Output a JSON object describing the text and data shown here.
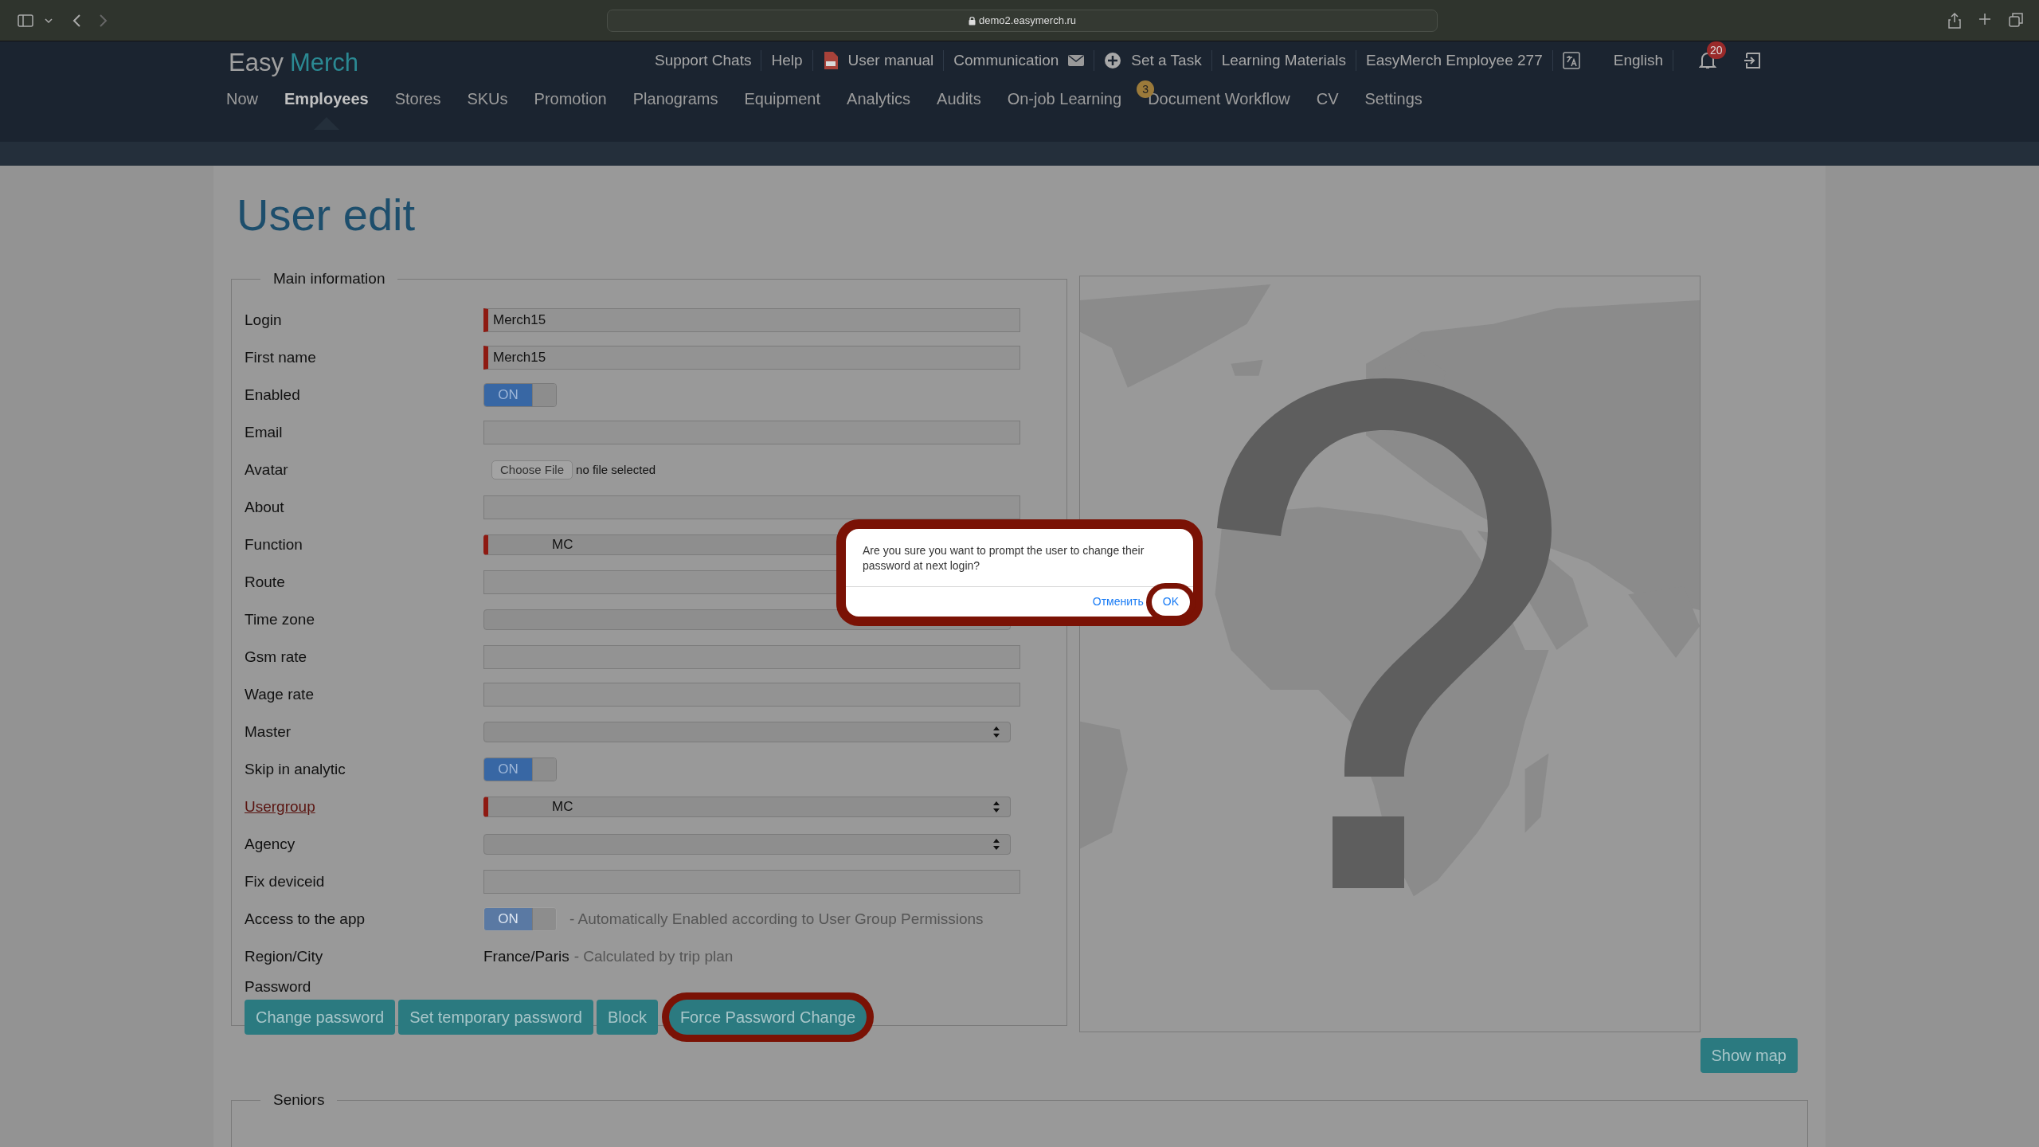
{
  "browser": {
    "url": "demo2.easymerch.ru"
  },
  "header": {
    "logo": {
      "first": "Easy",
      "second": "Merch"
    },
    "support_chats": "Support Chats",
    "help": "Help",
    "user_manual": "User manual",
    "communication": "Communication",
    "set_a_task": "Set a Task",
    "learning_materials": "Learning Materials",
    "user_name": "EasyMerch Employee 277",
    "language": "English",
    "notifications": "20",
    "nav": [
      {
        "label": "Now",
        "selected": false
      },
      {
        "label": "Employees",
        "selected": true
      },
      {
        "label": "Stores",
        "selected": false
      },
      {
        "label": "SKUs",
        "selected": false
      },
      {
        "label": "Promotion",
        "selected": false
      },
      {
        "label": "Planograms",
        "selected": false
      },
      {
        "label": "Equipment",
        "selected": false
      },
      {
        "label": "Analytics",
        "selected": false
      },
      {
        "label": "Audits",
        "selected": false
      },
      {
        "label": "On-job Learning",
        "selected": false
      },
      {
        "label": "Document Workflow",
        "selected": false,
        "badge": "3"
      },
      {
        "label": "CV",
        "selected": false
      },
      {
        "label": "Settings",
        "selected": false
      }
    ]
  },
  "title": "User edit",
  "main_information": {
    "legend": "Main information",
    "rows": [
      {
        "kind": "text",
        "label": "Login",
        "value": "Merch15",
        "required": true
      },
      {
        "kind": "text",
        "label": "First name",
        "value": "Merch15",
        "required": true
      },
      {
        "kind": "toggle",
        "label": "Enabled",
        "toggle": "ON",
        "on": true,
        "disabled": false
      },
      {
        "kind": "text",
        "label": "Email",
        "required": false
      },
      {
        "kind": "file",
        "label": "Avatar",
        "button": "Choose File",
        "status": "no file selected"
      },
      {
        "kind": "text",
        "label": "About",
        "required": false
      },
      {
        "kind": "select",
        "label": "Function",
        "value": "MC",
        "required": true
      },
      {
        "kind": "text",
        "label": "Route",
        "required": false
      },
      {
        "kind": "select",
        "label": "Time zone",
        "required": false
      },
      {
        "kind": "text",
        "label": "Gsm rate",
        "required": false
      },
      {
        "kind": "text",
        "label": "Wage rate",
        "required": false
      },
      {
        "kind": "select",
        "label": "Master",
        "required": false
      },
      {
        "kind": "toggle",
        "label": "Skip in analytic",
        "toggle": "ON",
        "on": true,
        "disabled": false
      },
      {
        "kind": "select",
        "label": "Usergroup",
        "value": "MC",
        "required": true,
        "link": true
      },
      {
        "kind": "select",
        "label": "Agency",
        "required": false
      },
      {
        "kind": "text",
        "label": "Fix deviceid",
        "required": false
      },
      {
        "kind": "toggle",
        "label": "Access to the app",
        "toggle": "ON",
        "on": true,
        "disabled": true,
        "note": "- Automatically Enabled according to User Group Permissions"
      },
      {
        "kind": "static",
        "label": "Region/City",
        "value": "France/Paris",
        "note": "- Calculated by trip plan"
      }
    ],
    "password": {
      "label": "Password",
      "buttons": [
        {
          "label": "Change password",
          "highlighted": false
        },
        {
          "label": "Set temporary password",
          "highlighted": false
        },
        {
          "label": "Block",
          "highlighted": false
        },
        {
          "label": "Force Password Change",
          "highlighted": true
        }
      ]
    }
  },
  "map": {
    "button": "Show map"
  },
  "seniors": {
    "legend": "Seniors"
  },
  "dialog": {
    "message": "Are you sure you want to prompt the user to change their password at next login?",
    "cancel": "Отменить",
    "ok": "OK",
    "ok_highlighted": true
  }
}
